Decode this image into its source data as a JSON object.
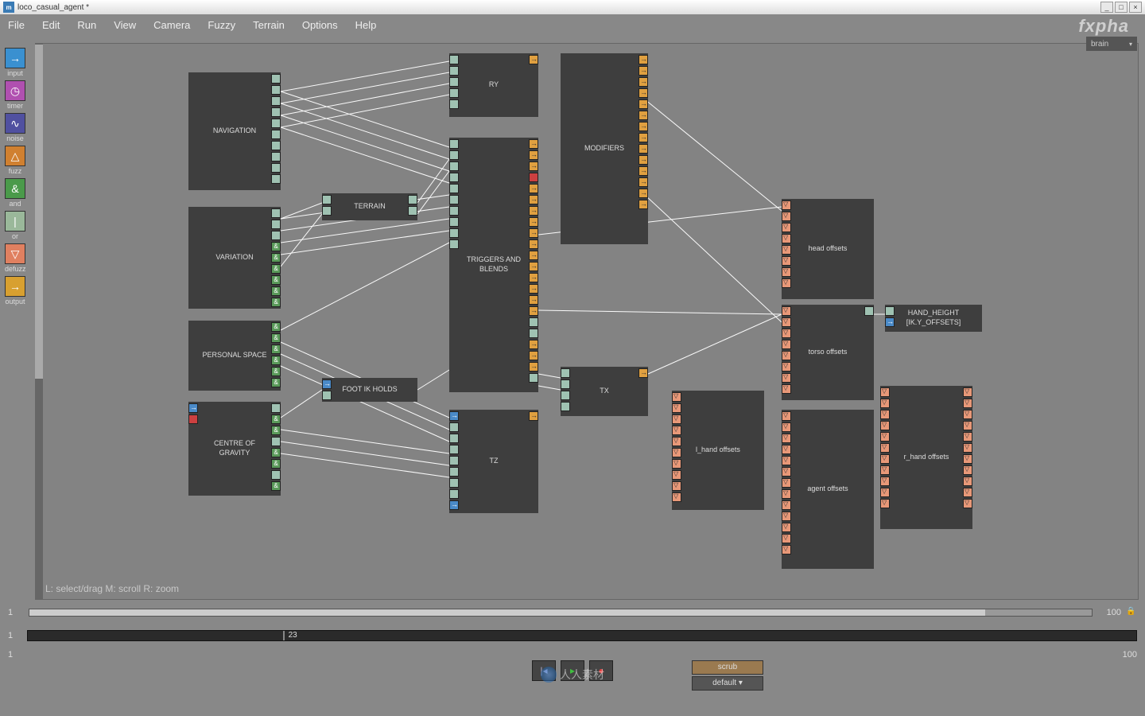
{
  "title": "loco_casual_agent *",
  "watermark": "fxpha",
  "center_wm": "人人素材",
  "menu": [
    "File",
    "Edit",
    "Run",
    "View",
    "Camera",
    "Fuzzy",
    "Terrain",
    "Options",
    "Help"
  ],
  "view_dropdown": "brain",
  "tools": [
    {
      "label": "input",
      "color": "#3a90d0",
      "glyph": "→"
    },
    {
      "label": "timer",
      "color": "#b050b0",
      "glyph": "◷"
    },
    {
      "label": "noise",
      "color": "#5050a0",
      "glyph": "∿"
    },
    {
      "label": "fuzz",
      "color": "#d08030",
      "glyph": "△"
    },
    {
      "label": "and",
      "color": "#4a9a4a",
      "glyph": "&"
    },
    {
      "label": "or",
      "color": "#9ab89a",
      "glyph": "|"
    },
    {
      "label": "defuzz",
      "color": "#e08060",
      "glyph": "▽"
    },
    {
      "label": "output",
      "color": "#d8a030",
      "glyph": "→"
    }
  ],
  "hint": "L: select/drag  M: scroll  R: zoom",
  "hscroll": {
    "left": "1",
    "right": "100"
  },
  "timeline": {
    "left": "1",
    "mark": "23"
  },
  "footer": {
    "left": "1",
    "right": "100"
  },
  "transport": {
    "prev": "|◂",
    "play": "▸",
    "rec": "●"
  },
  "modes": {
    "scrub": "scrub",
    "default": "default"
  },
  "nodes": {
    "navigation": "NAVIGATION",
    "variation": "VARIATION",
    "personal": "PERSONAL SPACE",
    "cog": "CENTRE OF GRAVITY",
    "terrain": "TERRAIN",
    "footik": "FOOT IK HOLDS",
    "ry": "RY",
    "triggers": "TRIGGERS AND BLENDS",
    "tz": "TZ",
    "tx": "TX",
    "modifiers": "MODIFIERS",
    "head": "head offsets",
    "torso": "torso offsets",
    "lhand": "l_hand offsets",
    "rhand": "r_hand offsets",
    "agent": "agent offsets",
    "handh1": "HAND_HEIGHT",
    "handh2": "[IK.Y_OFFSETS]"
  }
}
